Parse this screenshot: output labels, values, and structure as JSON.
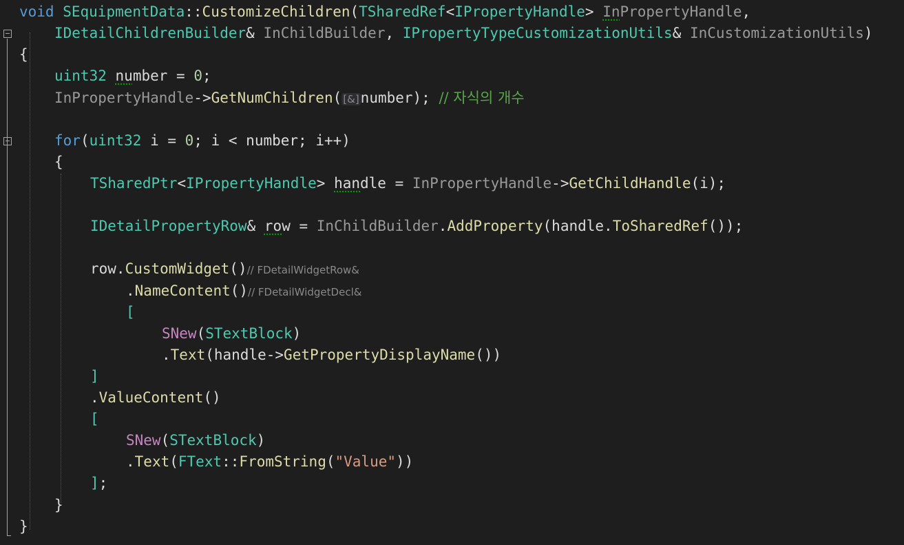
{
  "code": {
    "l1": {
      "ret_type": "void",
      "class_name": "SEquipmentData",
      "scope": "::",
      "func_name": "CustomizeChildren",
      "paren": "(",
      "t1": "TSharedRef",
      "lt": "<",
      "t2": "IPropertyHandle",
      "gt": ">",
      "param1_pre": " ",
      "param1_a": "In",
      "param1_b": "PropertyHandle",
      "comma": ","
    },
    "l2": {
      "t1": "IDetailChildrenBuilder",
      "amp1": "&",
      "p1": " InChildBuilder",
      "sep": ", ",
      "t2": "IPropertyTypeCustomizationUtils",
      "amp2": "&",
      "p2": " InCustomizationUtils",
      "close": ")"
    },
    "l3": {
      "brace": "{"
    },
    "l4": {
      "type": "uint32",
      "sp1": " ",
      "v1": "nu",
      "v2": "mber",
      "rest": " = ",
      "num": "0",
      "semi": ";"
    },
    "l5": {
      "recv": "InPropertyHandle",
      "arrow": "->",
      "fn": "GetNumChildren",
      "paren": "(",
      "hint": "[&]",
      "arg": "number",
      "close": ");",
      "sp": " ",
      "comment": "// 자식의 개수"
    },
    "l6": {
      "kw": "for",
      "paren": "(",
      "type": "uint32",
      "rest1": " i = ",
      "num": "0",
      "rest2": "; i < number; i++)"
    },
    "l7": {
      "brace": "{"
    },
    "l8": {
      "t1": "TSharedPtr",
      "lt": "<",
      "t2": "IPropertyHandle",
      "gt": ">",
      "sp": " ",
      "v1": "han",
      "v2": "dle",
      "eq": " = ",
      "recv": "InPropertyHandle",
      "arrow": "->",
      "fn": "GetChildHandle",
      "args": "(i);"
    },
    "l9": {
      "type": "IDetailPropertyRow",
      "amp": "&",
      "sp": " ",
      "v1": "ro",
      "v2": "w",
      "eq": " = ",
      "recv": "InChildBuilder",
      "dot": ".",
      "fn": "AddProperty",
      "p1": "(handle.",
      "fn2": "ToSharedRef",
      "p2": "());"
    },
    "l10": {
      "obj": "row.",
      "fn": "CustomWidget",
      "paren": "()",
      "hint": "// FDetailWidgetRow&"
    },
    "l11": {
      "dot": ".",
      "fn": "NameContent",
      "paren": "()",
      "hint": "// FDetailWidgetDecl&"
    },
    "l12": {
      "bracket": "["
    },
    "l13": {
      "macro": "SNew",
      "paren": "(",
      "type": "STextBlock",
      "close": ")"
    },
    "l14": {
      "dot": ".",
      "fn": "Text",
      "p1": "(handle",
      "arrow": "->",
      "fn2": "GetPropertyDisplayName",
      "p2": "())"
    },
    "l15": {
      "bracket": "]"
    },
    "l16": {
      "dot": ".",
      "fn": "ValueContent",
      "paren": "()"
    },
    "l17": {
      "bracket": "["
    },
    "l18": {
      "macro": "SNew",
      "paren": "(",
      "type": "STextBlock",
      "close": ")"
    },
    "l19": {
      "dot": ".",
      "fn": "Text",
      "p1": "(",
      "type": "FText",
      "scope": "::",
      "fn2": "FromString",
      "p2": "(",
      "str": "\"Value\"",
      "p3": "))"
    },
    "l20": {
      "bracket": "]",
      "semi": ";"
    },
    "l21": {
      "brace": "}"
    },
    "l22": {
      "brace": "}"
    }
  },
  "colors": {
    "background": "#1e1e1e",
    "keyword": "#569cd6",
    "type": "#4ec9b0",
    "function": "#dcdcaa",
    "parameter": "#9a9a9a",
    "macro": "#c586c0",
    "string": "#d69d85",
    "number": "#b5cea8",
    "comment": "#57a64a"
  },
  "icons": [
    "fold-collapse-icon"
  ]
}
